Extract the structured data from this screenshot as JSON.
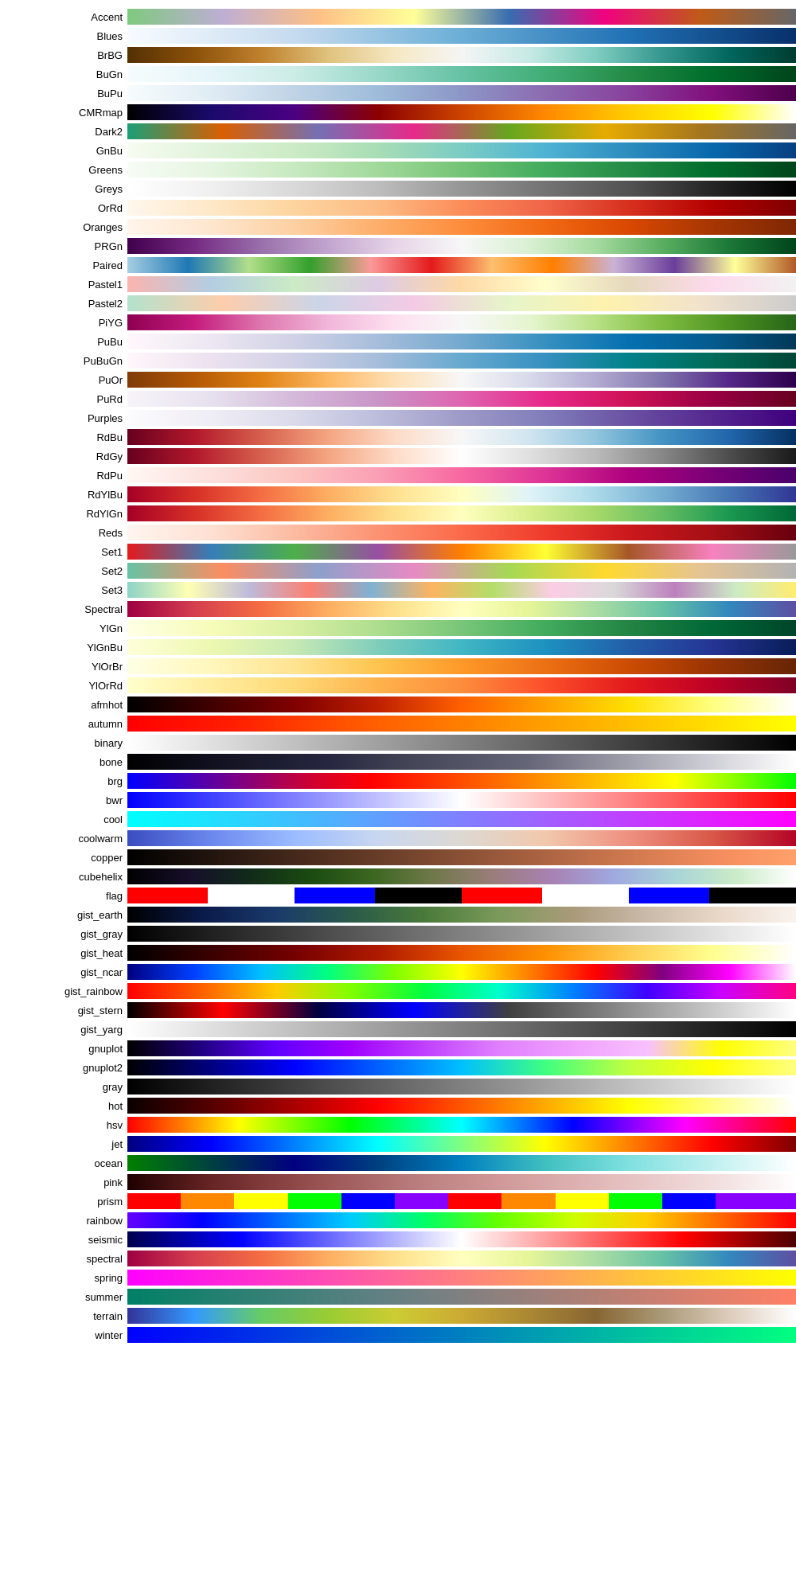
{
  "colormaps": [
    {
      "name": "Accent",
      "gradient": "linear-gradient(to right, #7fc97f, #beaed4, #fdc086, #ffff99, #386cb0, #f0027f, #bf5b17, #666666)"
    },
    {
      "name": "Blues",
      "gradient": "linear-gradient(to right, #f7fbff, #c6dbef, #6baed6, #2171b5, #08306b)"
    },
    {
      "name": "BrBG",
      "gradient": "linear-gradient(to right, #543005, #8c510a, #bf812d, #dfc27d, #f6e8c3, #f5f5f5, #c7eae5, #80cdc1, #35978f, #01665e, #003c30)"
    },
    {
      "name": "BuGn",
      "gradient": "linear-gradient(to right, #f7fcfd, #e5f5f9, #ccece6, #99d8c9, #66c2a4, #41ae76, #238b45, #006d2c, #00441b)"
    },
    {
      "name": "BuPu",
      "gradient": "linear-gradient(to right, #f7fcfd, #e0ecf4, #bfd3e6, #9ebcda, #8c96c6, #8c6bb1, #88419d, #810f7c, #4d004b)"
    },
    {
      "name": "CMRmap",
      "gradient": "linear-gradient(to right, #000000, #1a0a6b, #4b0082, #8b0000, #cc4400, #ff8800, #ffcc00, #ffff00, #ffffff)"
    },
    {
      "name": "Dark2",
      "gradient": "linear-gradient(to right, #1b9e77, #d95f02, #7570b3, #e7298a, #66a61e, #e6ab02, #a6761d, #666666)"
    },
    {
      "name": "GnBu",
      "gradient": "linear-gradient(to right, #f7fcf0, #e0f3db, #ccebc5, #a8ddb5, #7bccc4, #4eb3d3, #2b8cbe, #0868ac, #084081)"
    },
    {
      "name": "Greens",
      "gradient": "linear-gradient(to right, #f7fcf5, #e5f5e0, #c7e9c0, #a1d99b, #74c476, #41ab5d, #238b45, #006d2c, #00441b)"
    },
    {
      "name": "Greys",
      "gradient": "linear-gradient(to right, #ffffff, #f0f0f0, #d9d9d9, #bdbdbd, #969696, #737373, #525252, #252525, #000000)"
    },
    {
      "name": "OrRd",
      "gradient": "linear-gradient(to right, #fff7ec, #fee8c8, #fdd49e, #fdbb84, #fc8d59, #ef6548, #d7301f, #b30000, #7f0000)"
    },
    {
      "name": "Oranges",
      "gradient": "linear-gradient(to right, #fff5eb, #fee6ce, #fdd0a2, #fdae6b, #fd8d3c, #f16913, #d94801, #a63603, #7f2704)"
    },
    {
      "name": "PRGn",
      "gradient": "linear-gradient(to right, #40004b, #762a83, #9970ab, #c2a5cf, #e7d4e8, #f7f7f7, #d9f0d3, #a6dba0, #5aae61, #1b7837, #00441b)"
    },
    {
      "name": "Paired",
      "gradient": "linear-gradient(to right, #a6cee3, #1f78b4, #b2df8a, #33a02c, #fb9a99, #e31a1c, #fdbf6f, #ff7f00, #cab2d6, #6a3d9a, #ffff99, #b15928)"
    },
    {
      "name": "Pastel1",
      "gradient": "linear-gradient(to right, #fbb4ae, #b3cde3, #ccebc5, #decbe4, #fed9a6, #ffffcc, #e5d8bd, #fddaec, #f2f2f2)"
    },
    {
      "name": "Pastel2",
      "gradient": "linear-gradient(to right, #b3e2cd, #fdcdac, #cbd5e8, #f4cae4, #e6f5c9, #fff2ae, #f1e2cc, #cccccc)"
    },
    {
      "name": "PiYG",
      "gradient": "linear-gradient(to right, #8e0152, #c51b7d, #de77ae, #f1b6da, #fde0ef, #f7f7f7, #e6f5d0, #b8e186, #7fbc41, #4d9221, #276419)"
    },
    {
      "name": "PuBu",
      "gradient": "linear-gradient(to right, #fff7fb, #ece7f2, #d0d1e6, #a6bddb, #74a9cf, #3690c0, #0570b0, #045a8d, #023858)"
    },
    {
      "name": "PuBuGn",
      "gradient": "linear-gradient(to right, #fff7fb, #ece2f0, #d0d1e6, #a6bddb, #67a9cf, #3690c0, #02818a, #016c59, #014636)"
    },
    {
      "name": "PuOr",
      "gradient": "linear-gradient(to right, #7f3b08, #b35806, #e08214, #fdb863, #fee0b6, #f7f7f7, #d8daeb, #b2abd2, #8073ac, #542788, #2d004b)"
    },
    {
      "name": "PuRd",
      "gradient": "linear-gradient(to right, #f7f4f9, #e7e1ef, #d4b9da, #c994c7, #df65b0, #e7298a, #ce1256, #980043, #67001f)"
    },
    {
      "name": "Purples",
      "gradient": "linear-gradient(to right, #fcfbfd, #efedf5, #dadaeb, #bcbddc, #9e9ac8, #807dba, #6a51a3, #54278f, #3f007d)"
    },
    {
      "name": "RdBu",
      "gradient": "linear-gradient(to right, #67001f, #b2182b, #d6604d, #f4a582, #fddbc7, #f7f7f7, #d1e5f0, #92c5de, #4393c3, #2166ac, #053061)"
    },
    {
      "name": "RdGy",
      "gradient": "linear-gradient(to right, #67001f, #b2182b, #d6604d, #f4a582, #fddbc7, #ffffff, #e0e0e0, #bababa, #878787, #4d4d4d, #1a1a1a)"
    },
    {
      "name": "RdPu",
      "gradient": "linear-gradient(to right, #fff7f3, #fde0dd, #fcc5c0, #fa9fb5, #f768a1, #dd3497, #ae017e, #7a0177, #49006a)"
    },
    {
      "name": "RdYlBu",
      "gradient": "linear-gradient(to right, #a50026, #d73027, #f46d43, #fdae61, #fee090, #ffffbf, #e0f3f8, #abd9e9, #74add1, #4575b4, #313695)"
    },
    {
      "name": "RdYlGn",
      "gradient": "linear-gradient(to right, #a50026, #d73027, #f46d43, #fdae61, #fee08b, #ffffbf, #d9ef8b, #a6d96a, #66bd63, #1a9850, #006837)"
    },
    {
      "name": "Reds",
      "gradient": "linear-gradient(to right, #fff5f0, #fee0d2, #fcbba1, #fc9272, #fb6a4a, #ef3b2c, #cb181d, #a50f15, #67000d)"
    },
    {
      "name": "Set1",
      "gradient": "linear-gradient(to right, #e41a1c, #377eb8, #4daf4a, #984ea3, #ff7f00, #ffff33, #a65628, #f781bf, #999999)"
    },
    {
      "name": "Set2",
      "gradient": "linear-gradient(to right, #66c2a5, #fc8d62, #8da0cb, #e78ac3, #a6d854, #ffd92f, #e5c494, #b3b3b3)"
    },
    {
      "name": "Set3",
      "gradient": "linear-gradient(to right, #8dd3c7, #ffffb3, #bebada, #fb8072, #80b1d3, #fdb462, #b3de69, #fccde5, #d9d9d9, #bc80bd, #ccebc5, #ffed6f)"
    },
    {
      "name": "Spectral",
      "gradient": "linear-gradient(to right, #9e0142, #d53e4f, #f46d43, #fdae61, #fee08b, #ffffbf, #e6f598, #abdda4, #66c2a5, #3288bd, #5e4fa2)"
    },
    {
      "name": "YlGn",
      "gradient": "linear-gradient(to right, #ffffe5, #f7fcb9, #d9f0a3, #addd8e, #78c679, #41ab5d, #238443, #006837, #004529)"
    },
    {
      "name": "YlGnBu",
      "gradient": "linear-gradient(to right, #ffffd9, #edf8b1, #c7e9b4, #7fcdbb, #41b6c4, #1d91c0, #225ea8, #253494, #081d58)"
    },
    {
      "name": "YlOrBr",
      "gradient": "linear-gradient(to right, #ffffe5, #fff7bc, #fee391, #fec44f, #fe9929, #ec7014, #cc4c02, #993404, #662506)"
    },
    {
      "name": "YlOrRd",
      "gradient": "linear-gradient(to right, #ffffcc, #ffeda0, #fed976, #feb24c, #fd8d3c, #fc4e2a, #e31a1c, #bd0026, #800026)"
    },
    {
      "name": "afmhot",
      "gradient": "linear-gradient(to right, #000000, #400000, #800000, #bf2000, #ff6000, #ffa000, #ffe000, #ffff80, #ffffff)"
    },
    {
      "name": "autumn",
      "gradient": "linear-gradient(to right, #ff0000, #ff2000, #ff5500, #ff7f00, #ffaa00, #ffd500, #ffff00)"
    },
    {
      "name": "binary",
      "gradient": "linear-gradient(to right, #ffffff, #e0e0e0, #c0c0c0, #a0a0a0, #808080, #606060, #404040, #202020, #000000)"
    },
    {
      "name": "bone",
      "gradient": "linear-gradient(to right, #000000, #0d0d1a, #1a1a2d, #262640, #404053, #535366, #666679, #8c8c9a, #b3b3be, #d9d9df, #ffffff)"
    },
    {
      "name": "brg",
      "gradient": "linear-gradient(to right, #0000ff, #4400bb, #880077, #cc0033, #ff0000, #ff3300, #ff6600, #ff9900, #ffcc00, #ffff00, #88ff00, #00ff00)"
    },
    {
      "name": "bwr",
      "gradient": "linear-gradient(to right, #0000ff, #4040ff, #8080ff, #c0c0ff, #ffffff, #ffc0c0, #ff8080, #ff4040, #ff0000)"
    },
    {
      "name": "cool",
      "gradient": "linear-gradient(to right, #00ffff, #20dfff, #40bfff, #609fff, #807fff, #a05fff, #c03fff, #e01fff, #ff00ff)"
    },
    {
      "name": "coolwarm",
      "gradient": "linear-gradient(to right, #3b4cc0, #6b88ee, #9bbcff, #c9d7f0, #ddd8d2, #f2c8ac, #ee9080, #d95847, #b40426)"
    },
    {
      "name": "copper",
      "gradient": "linear-gradient(to right, #000000, #1e120c, #3d2418, #5c3623, #7a482f, #99593b, #b86b47, #d77d52, #f58e5e, #ffa06a)"
    },
    {
      "name": "cubehelix",
      "gradient": "linear-gradient(to right, #000000, #160e2a, #112a1a, #1a4a10, #3a6620, #6e7848, #9a7d7a, #a882b4, #9fa8df, #a8d4d8, #caebc8, #ffffff)"
    },
    {
      "name": "flag",
      "gradient": "repeating-linear-gradient(to right, #ff0000 0%, #ff0000 12%, #ffffff 12%, #ffffff 25%, #0000ff 25%, #0000ff 37%, #000000 37%, #000000 50%, #ff0000 50%, #ff0000 62%, #ffffff 62%, #ffffff 75%, #0000ff 75%, #0000ff 87%, #000000 87%, #000000 100%)"
    },
    {
      "name": "gist_earth",
      "gradient": "linear-gradient(to right, #000000, #0a1a4a, #1a3a6a, #2a5a4a, #4a7a3a, #7a9a5a, #aa9a7a, #cabaaa, #ead9c9, #f9f3ee)"
    },
    {
      "name": "gist_gray",
      "gradient": "linear-gradient(to right, #000000, #404040, #808080, #c0c0c0, #ffffff)"
    },
    {
      "name": "gist_heat",
      "gradient": "linear-gradient(to right, #000000, #3a0000, #750000, #af1a00, #e95500, #ff9000, #ffcc50, #ffff90, #ffffff)"
    },
    {
      "name": "gist_ncar",
      "gradient": "linear-gradient(to right, #000080, #0040ff, #00c0ff, #00ff80, #80ff00, #ffff00, #ff8000, #ff0000, #800080, #ff00ff, #ffffff)"
    },
    {
      "name": "gist_rainbow",
      "gradient": "linear-gradient(to right, #ff0000, #ff6000, #ffcc00, #80ff00, #00ff40, #00ffcc, #0080ff, #4000ff, #cc00ff, #ff0080)"
    },
    {
      "name": "gist_stern",
      "gradient": "linear-gradient(to right, #000000, #ff0000, #000040, #0000ff, #404040, #808080, #c0c0c0, #ffffff)"
    },
    {
      "name": "gist_yarg",
      "gradient": "linear-gradient(to right, #ffffff, #e0e0e0, #c0c0c0, #a0a0a0, #808080, #606060, #404040, #202020, #000000)"
    },
    {
      "name": "gnuplot",
      "gradient": "linear-gradient(to right, #000000, #200080, #6000ff, #a000ff, #c040ff, #e080ff, #f0a0ff, #f8c0ff, #ffff00, #ffff80)"
    },
    {
      "name": "gnuplot2",
      "gradient": "linear-gradient(to right, #000000, #000080, #0000ff, #0060ff, #00c0ff, #40ff80, #c0ff40, #ffff00, #ffff80)"
    },
    {
      "name": "gray",
      "gradient": "linear-gradient(to right, #000000, #404040, #808080, #c0c0c0, #ffffff)"
    },
    {
      "name": "hot",
      "gradient": "linear-gradient(to right, #0a0000, #550000, #aa0000, #ff0000, #ff5500, #ffaa00, #ffff00, #ffff80, #ffffff)"
    },
    {
      "name": "hsv",
      "gradient": "linear-gradient(to right, #ff0000, #ffff00, #00ff00, #00ffff, #0000ff, #ff00ff, #ff0000)"
    },
    {
      "name": "jet",
      "gradient": "linear-gradient(to right, #000080, #0000ff, #0080ff, #00ffff, #80ff80, #ffff00, #ff8000, #ff0000, #800000)"
    },
    {
      "name": "ocean",
      "gradient": "linear-gradient(to right, #008000, #004040, #000080, #004080, #0080c0, #40c0c0, #80e0e0, #c0f0f0, #ffffff)"
    },
    {
      "name": "pink",
      "gradient": "linear-gradient(to right, #1e0000, #612020, #874040, #a46060, #bc8080, #d09898, #ddb0b0, #e9c8c8, #f3e0e0, #ffffff)"
    },
    {
      "name": "prism",
      "gradient": "repeating-linear-gradient(to right, #ff0000 0%, #ff0000 8%, #ff8800 8%, #ff8800 16%, #ffff00 16%, #ffff00 24%, #00ff00 24%, #00ff00 32%, #0000ff 32%, #0000ff 40%, #8800ff 40%, #8800ff 48%, #ff0000 48%, #ff0000 56%, #ff8800 56%, #ff8800 64%, #ffff00 64%, #ffff00 72%, #00ff00 72%, #00ff00 80%, #0000ff 80%, #0000ff 88%, #8800ff 88%, #8800ff 100%)"
    },
    {
      "name": "rainbow",
      "gradient": "linear-gradient(to right, #6600ff, #0000ff, #0066ff, #00ccff, #00ff66, #66ff00, #ccff00, #ffcc00, #ff6600, #ff0000)"
    },
    {
      "name": "seismic",
      "gradient": "linear-gradient(to right, #00004d, #0000ff, #8080ff, #ffffff, #ff8080, #ff0000, #4d0000)"
    },
    {
      "name": "spectral",
      "gradient": "linear-gradient(to right, #9e0142, #d53e4f, #f46d43, #fdae61, #fee08b, #ffffbf, #e6f598, #abdda4, #66c2a5, #3288bd, #5e4fa2)"
    },
    {
      "name": "spring",
      "gradient": "linear-gradient(to right, #ff00ff, #ff20df, #ff40bf, #ff609f, #ff807f, #ffa05f, #ffc03f, #ffe01f, #ffff00)"
    },
    {
      "name": "summer",
      "gradient": "linear-gradient(to right, #008066, #208070, #408079, #608083, #808080, #a0807a, #c08073, #e0806d, #ff8066)"
    },
    {
      "name": "terrain",
      "gradient": "linear-gradient(to right, #333399, #3399ff, #66cc66, #99cc33, #cccc33, #ccaa33, #aa8833, #886633, #aa9977, #ddccbb, #ffffff)"
    },
    {
      "name": "winter",
      "gradient": "linear-gradient(to right, #0000ff, #0020ef, #0040df, #0060cf, #0080bf, #00a0af, #00c09f, #00e08f, #00ff80)"
    }
  ]
}
